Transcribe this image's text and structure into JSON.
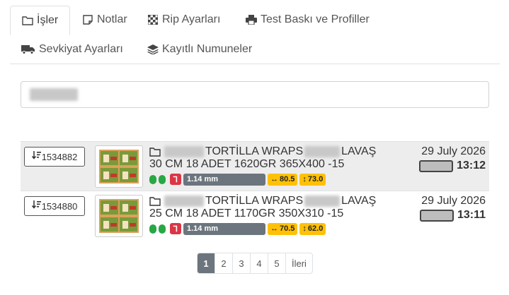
{
  "tabs": [
    {
      "label": "İşler",
      "icon": "folder-icon"
    },
    {
      "label": "Notlar",
      "icon": "note-icon"
    },
    {
      "label": "Rip Ayarları",
      "icon": "checker-icon"
    },
    {
      "label": "Test Baskı ve Profiller",
      "icon": "printer-icon"
    },
    {
      "label": "Sevkiyat Ayarları",
      "icon": "truck-icon"
    },
    {
      "label": "Kayıtlı Numuneler",
      "icon": "layers-icon"
    }
  ],
  "jobs": [
    {
      "id": "1534882",
      "line1_mid": "TORTİLLA WRAPS",
      "line1_end": "LAVAŞ",
      "line2": "30 CM 18 ADET 1620GR 365X400 -15",
      "red_badge": "Ꞁ",
      "thickness": "1.14 mm",
      "width": "80.5",
      "height": "73.0",
      "date": "29 July 2026",
      "time": "13:12"
    },
    {
      "id": "1534880",
      "line1_mid": "TORTİLLA WRAPS",
      "line1_end": "LAVAŞ",
      "line2": "25 CM 18 ADET 1170GR 350X310 -15",
      "red_badge": "Ꞁ",
      "thickness": "1.14 mm",
      "width": "70.5",
      "height": "62.0",
      "date": "29 July 2026",
      "time": "13:11"
    }
  ],
  "pagination": {
    "pages": [
      "1",
      "2",
      "3",
      "4",
      "5"
    ],
    "next": "İleri",
    "active": "1"
  },
  "colors": {
    "green": "#28a745",
    "red": "#dc3545",
    "gray": "#6c757d",
    "yellow": "#ffc107"
  }
}
